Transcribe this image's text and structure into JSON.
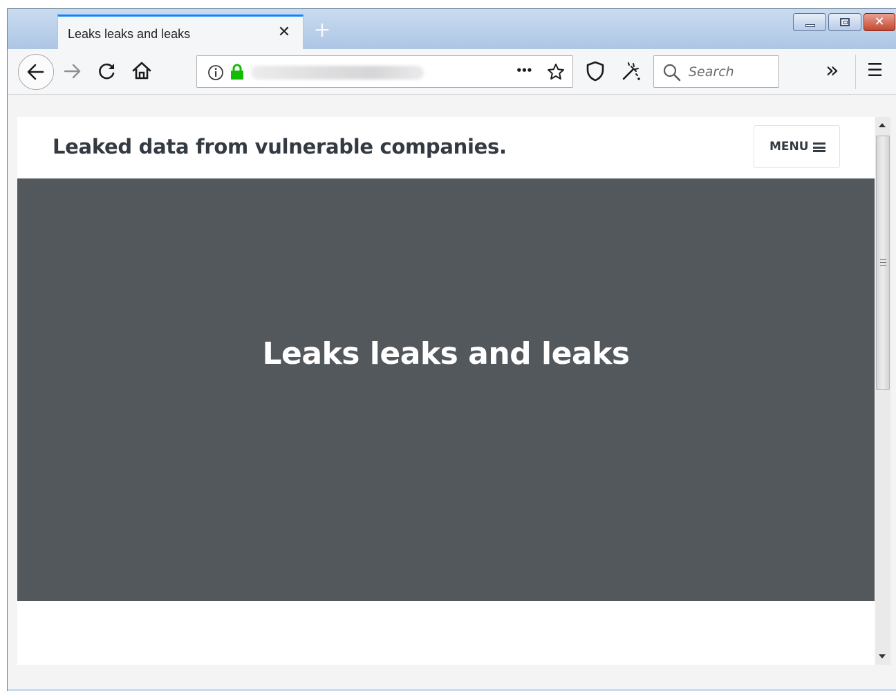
{
  "browser": {
    "tab_title": "Leaks leaks and leaks",
    "tab_close": "✕",
    "new_tab": "+",
    "url_placeholder_blurred": "",
    "more_actions": "•••",
    "search_placeholder": "Search",
    "overflow": "»",
    "hamburger": "☰"
  },
  "site": {
    "header_title": "Leaked data from vulnerable companies.",
    "menu_label": "MENU",
    "hero_title": "Leaks leaks and leaks"
  },
  "colors": {
    "hero_bg": "#53585d",
    "title_text": "#333a42",
    "lock_green": "#12bc00",
    "tab_accent": "#0a84ff"
  }
}
